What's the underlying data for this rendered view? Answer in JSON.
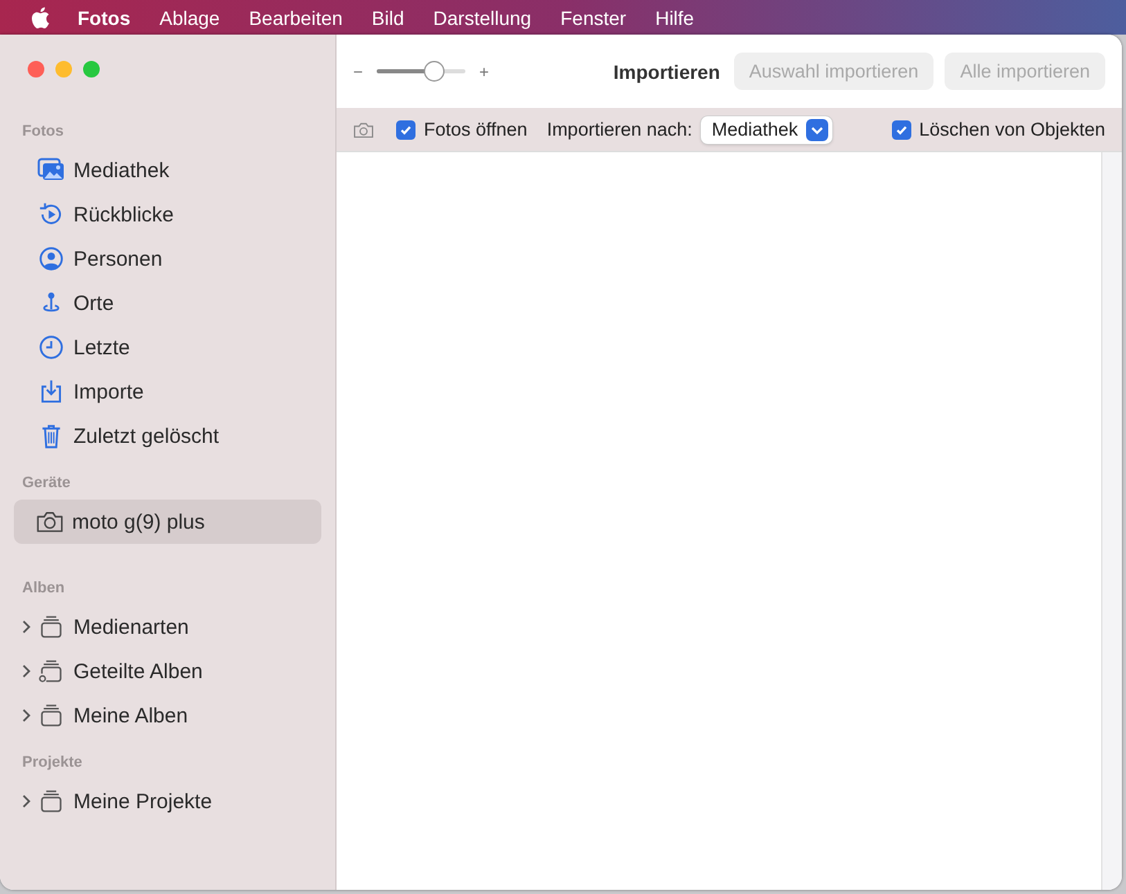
{
  "menu_bar": {
    "items": [
      {
        "label": "Fotos",
        "kind": "app"
      },
      {
        "label": "Ablage",
        "kind": "menu"
      },
      {
        "label": "Bearbeiten",
        "kind": "menu"
      },
      {
        "label": "Bild",
        "kind": "menu"
      },
      {
        "label": "Darstellung",
        "kind": "menu"
      },
      {
        "label": "Fenster",
        "kind": "menu"
      },
      {
        "label": "Hilfe",
        "kind": "menu"
      }
    ]
  },
  "toolbar": {
    "zoom": {
      "minus": "−",
      "plus": "+",
      "level": 0.65
    },
    "title": "Importieren",
    "buttons": [
      {
        "label": "Auswahl importieren",
        "disabled": true
      },
      {
        "label": "Alle importieren",
        "disabled": true
      }
    ]
  },
  "import_options": {
    "open_photos": {
      "label": "Fotos öffnen",
      "checked": true
    },
    "destination_label": "Importieren nach:",
    "destination": "Mediathek",
    "delete_items": {
      "label": "Löschen von Objekten",
      "checked": true
    }
  },
  "sidebar": {
    "sections": [
      {
        "title": "Fotos",
        "items": [
          {
            "label": "Mediathek",
            "selected": false
          },
          {
            "label": "Rückblicke",
            "selected": false
          },
          {
            "label": "Personen",
            "selected": false
          },
          {
            "label": "Orte",
            "selected": false
          },
          {
            "label": "Letzte",
            "selected": false
          },
          {
            "label": "Importe",
            "selected": false
          },
          {
            "label": "Zuletzt gelöscht",
            "selected": false
          }
        ]
      },
      {
        "title": "Geräte",
        "items": [
          {
            "label": "moto g(9) plus",
            "selected": true
          }
        ]
      },
      {
        "title": "Alben",
        "items": [
          {
            "label": "Medienarten",
            "selected": false,
            "expanded": false
          },
          {
            "label": "Geteilte Alben",
            "selected": false,
            "expanded": false
          },
          {
            "label": "Meine Alben",
            "selected": false,
            "expanded": false
          }
        ]
      },
      {
        "title": "Projekte",
        "items": [
          {
            "label": "Meine Projekte",
            "selected": false,
            "expanded": false
          }
        ]
      }
    ]
  }
}
